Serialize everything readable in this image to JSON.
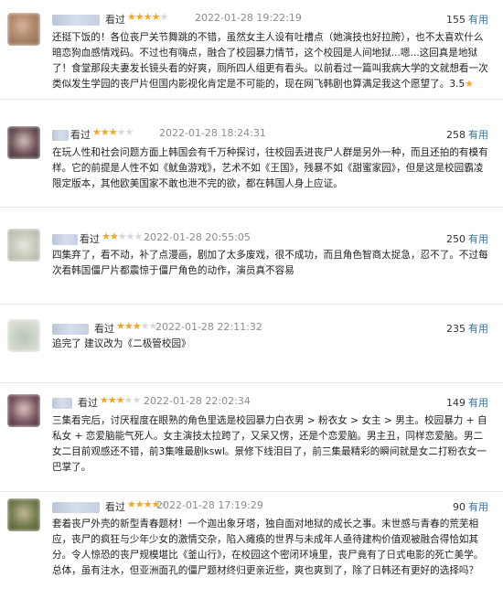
{
  "rating_label": "看过",
  "useful_label": "有用",
  "colors": {
    "star": "#f5a623",
    "link": "#3377aa",
    "meta": "#8c8c8c"
  },
  "reviews": [
    {
      "stars": 4,
      "time": "2022-01-28 19:22:19",
      "votes": "155",
      "text": "还挺下饭的！各位丧尸关节舞跳的不错，虽然女主人设有吐槽点（她演技也好拉胯），也不太喜欢什么暗恋狗血感情戏码。不过也有嗨点，融合了校园暴力情节，这个校园是人间地狱...嗯...这回真是地狱了！食堂那段夫妻发长镜头看的好爽，厕所四人组更有看头。以前看过一篇叫我病大学的文就想看一次类似发生学园的丧尸片但国内影视化肯定是不可能的，现在网飞韩剧也算满足我这个愿望了。3.5",
      "text_star": "★"
    },
    {
      "stars": 3,
      "time": "2022-01-28 18:24:31",
      "votes": "258",
      "text": "在玩人性和社会问题方面上韩国会有千万种探讨，往校园丢进丧尸人群是另外一种，而且还拍的有模有样。它的前提是人性不如《鱿鱼游戏》，艺术不如《王国》，残暴不如《甜蜜家园》，但是这是校园霸凌限定版本，其他欧美国家不敢也泄不完的欲，都在韩国人身上应证。"
    },
    {
      "stars": 2,
      "time": "2022-01-28 20:55:05",
      "votes": "250",
      "text": "四集弃了，看不动，补了点漫画，剧加了太多废戏，很不成功，而且角色智商太捉急，忍不了。不过每次看韩国僵尸片都震惊于僵尸角色的动作，演员真不容易"
    },
    {
      "stars": 3,
      "time": "2022-01-28 22:11:32",
      "votes": "235",
      "text": "追完了 建议改为《二极管校园》"
    },
    {
      "stars": 3,
      "time": "2022-01-28 22:02:34",
      "votes": "149",
      "text": "三集看完后，讨厌程度在眼熟的角色里选是校园暴力白衣男 > 粉衣女 > 女主 > 男主。校园暴力 + 自私女 + 恋爱脑能气死人。女主演技太拉跨了，又呆又愣，还是个恋爱脑。男主丑，同样恋爱脑。男二女二目前观感还不错，前3集唯最剧kswl。景修下线泪目了，前三集最精彩的瞬间就是女二打粉衣女一巴掌了。"
    },
    {
      "stars": 4,
      "time": "2022-01-28 17:19:29",
      "votes": "90",
      "text": "套着丧尸外壳的新型青春题材！一个迦出象牙塔，独自面对地狱的成长之事。末世感与青春的荒芜相应，丧尸的疯狂与少年少女的激情交杂，陷入瘫痪的世界与未成年人亟待建构价值观被融合得恰如其分。令人惊恐的丧尸规模堪比《釜山行》，在校园这个密闭环境里，丧尸竟有了日式电影的死亡美学。总体，虽有注水，但亚洲面孔的僵尸题材终归更亲近些，爽也爽到了，除了日韩还有更好的选择吗？"
    }
  ]
}
